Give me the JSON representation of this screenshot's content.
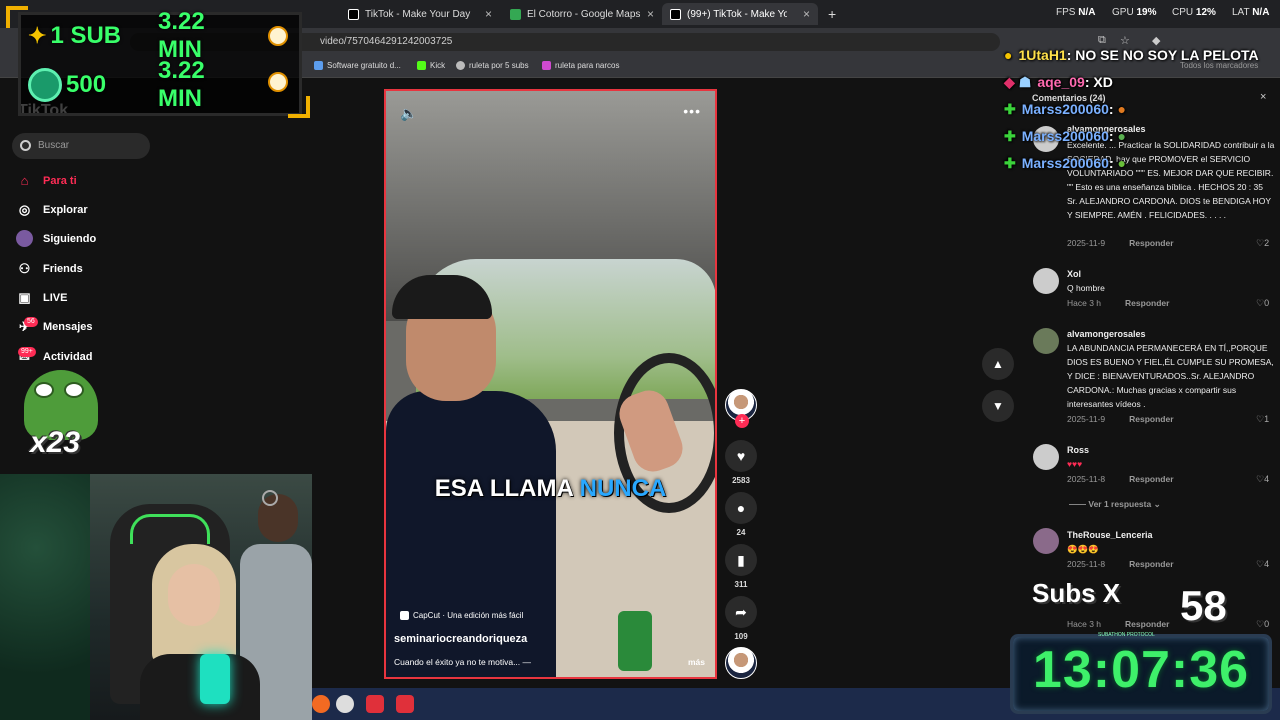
{
  "browser": {
    "tabs": [
      {
        "label": "TikTok - Make Your Day"
      },
      {
        "label": "El Cotorro - Google Maps"
      },
      {
        "label": "(99+) TikTok - Make Your Da"
      }
    ],
    "new_tab": "+",
    "perf": {
      "fps_label": "FPS",
      "fps": "N/A",
      "gpu_label": "GPU",
      "gpu": "19%",
      "cpu_label": "CPU",
      "cpu": "12%",
      "lat_label": "LAT",
      "lat": "N/A"
    },
    "url": "video/7570464291242003725",
    "bookmarks": [
      "Software gratuito d...",
      "Kick",
      "ruleta por 5 subs",
      "ruleta para narcos"
    ],
    "all_bookmarks": "Todos los marcadores"
  },
  "overlay": {
    "sub_count": "1 SUB",
    "sub_time": "3.22 MIN",
    "gift_count": "500",
    "gift_time": "3.22 MIN",
    "multiplier": "x23"
  },
  "sidebar": {
    "logo": "TikTok",
    "search_placeholder": "Buscar",
    "items": [
      {
        "label": "Para ti",
        "icon": "home-icon"
      },
      {
        "label": "Explorar",
        "icon": "compass-icon"
      },
      {
        "label": "Siguiendo",
        "icon": "following-icon"
      },
      {
        "label": "Friends",
        "icon": "friends-icon"
      },
      {
        "label": "LIVE",
        "icon": "live-icon"
      },
      {
        "label": "Mensajes",
        "icon": "messages-icon"
      },
      {
        "label": "Actividad",
        "icon": "activity-icon"
      }
    ],
    "messages_badge": "56",
    "activity_badge": "99+"
  },
  "video": {
    "caption_white": "ESA LLAMA",
    "caption_highlight": "NUNCA",
    "capcut_label": "CapCut · Una edición más fácil",
    "author": "seminariocreandoriqueza",
    "description": "Cuando el éxito ya no te motiva... —",
    "more": "más",
    "likes": "2583",
    "comments": "24",
    "saves": "311",
    "shares": "109",
    "follow_plus": "+"
  },
  "chat": [
    {
      "user": "1UtaH1",
      "message": ": NO SE NO SOY LA PELOTA"
    },
    {
      "user": "aqe_09",
      "message": ": XD"
    },
    {
      "user": "Marss200060",
      "message": ":"
    },
    {
      "user": "Marss200060",
      "message": ":"
    },
    {
      "user": "Marss200060",
      "message": ":"
    }
  ],
  "comments_panel": {
    "header": "Comentarios (24)",
    "close": "×",
    "reply_label": "Responder",
    "view_replies": "Ver 1 respuesta",
    "items": [
      {
        "user": "alvamongerosales",
        "text": "Excelente. ... Practicar la SOLIDARIDAD contribuir a la SOCIEDAD, hay que PROMOVER el SERVICIO VOLUNTARIADO \"\"\" ES. MEJOR DAR QUE RECIBIR. \"\" Esto es una enseñanza bíblica . HECHOS 20 : 35 Sr. ALEJANDRO CARDONA. DIOS te BENDIGA HOY Y SIEMPRE. AMÉN . FELICIDADES. . . . .",
        "date": "2025-11-9",
        "likes": "2"
      },
      {
        "user": "Xol",
        "text": "Q hombre",
        "date": "Hace 3 h",
        "likes": "0"
      },
      {
        "user": "alvamongerosales",
        "text": "LA ABUNDANCIA PERMANECERÁ EN TÍ,,PORQUE DIOS ES BUENO Y FIEL,ÉL CUMPLE SU PROMESA, Y DICE : BIENAVENTURADOS..Sr. ALEJANDRO CARDONA.: Muchas gracias x compartir sus interesantes vídeos .",
        "date": "2025-11-9",
        "likes": "1"
      },
      {
        "user": "Ross",
        "text": "♥♥♥",
        "date": "2025-11-8",
        "likes": "4"
      },
      {
        "user": "TheRouse_Lenceria",
        "text": "😍😍😍",
        "date": "2025-11-8",
        "likes": "4"
      },
      {
        "user": "",
        "text": "",
        "date": "Hace 3 h",
        "likes": "0"
      }
    ]
  },
  "subathon": {
    "subs_label": "Subs X",
    "subs_value": "58",
    "timer": "13:07:36",
    "timer_label": "SUBATHON PROTOCOL"
  },
  "colors": {
    "accent": "#fe2c55",
    "timer": "#3ef06a",
    "caption_highlight": "#29a8ff"
  }
}
